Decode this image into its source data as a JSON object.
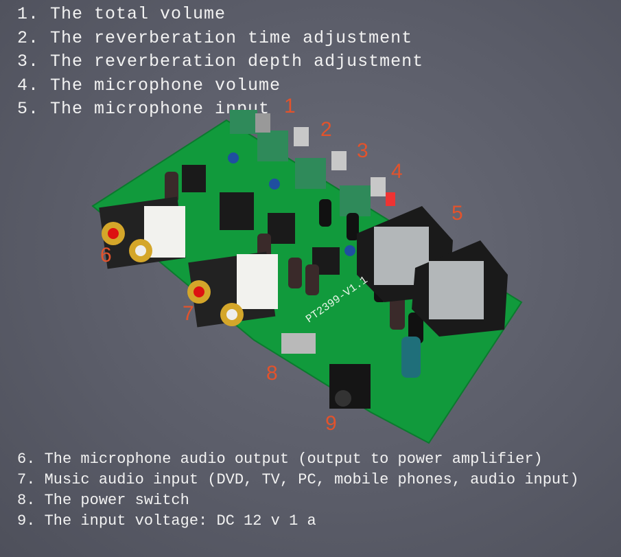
{
  "top_labels": [
    "1. The total volume",
    "2. The reverberation time adjustment",
    "3. The reverberation depth adjustment",
    "4. The microphone volume",
    "5. The microphone input"
  ],
  "bottom_labels": [
    "6. The microphone audio output (output to power amplifier)",
    "7. Music audio input (DVD, TV, PC, mobile phones, audio input)",
    "8. The power switch",
    "9. The input voltage: DC 12 v 1 a"
  ],
  "callouts": [
    "1",
    "2",
    "3",
    "4",
    "5",
    "6",
    "7",
    "8",
    "9"
  ],
  "board": {
    "silkscreen": "PT2399-V1.1",
    "color": "#119a3c"
  },
  "colors": {
    "text": "#f2f2f2",
    "callout": "#e2532c",
    "background": "#5b5d69"
  }
}
